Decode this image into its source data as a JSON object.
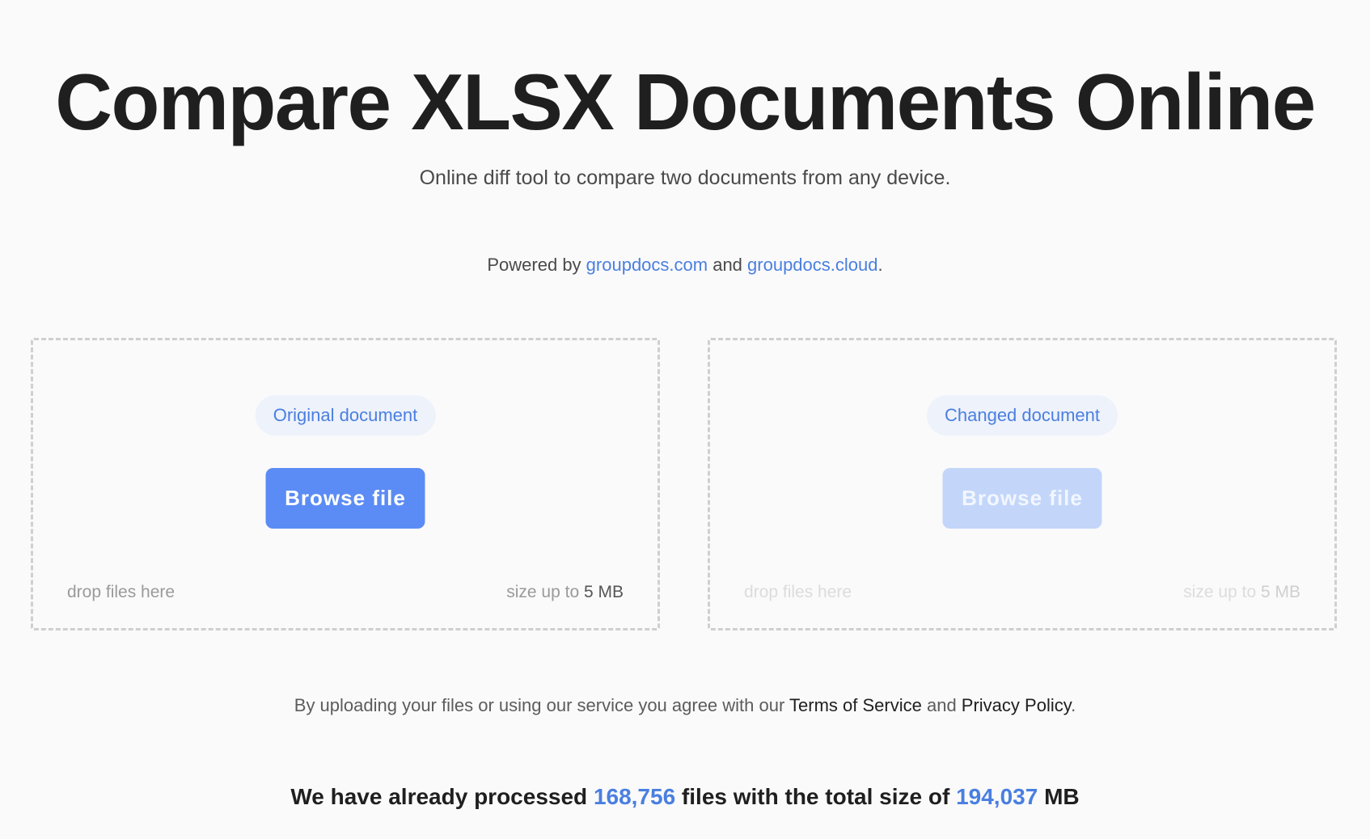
{
  "header": {
    "title": "Compare XLSX Documents Online",
    "subtitle": "Online diff tool to compare two documents from any device."
  },
  "powered": {
    "prefix": "Powered by ",
    "link1": "groupdocs.com",
    "middle": " and ",
    "link2": "groupdocs.cloud",
    "suffix": "."
  },
  "upload": {
    "original": {
      "label": "Original document",
      "button": "Browse file",
      "drop_hint": "drop files here",
      "size_prefix": "size up to ",
      "size_value": "5 MB"
    },
    "changed": {
      "label": "Changed document",
      "button": "Browse file",
      "drop_hint": "drop files here",
      "size_prefix": "size up to ",
      "size_value": "5 MB"
    }
  },
  "terms": {
    "prefix": "By uploading your files or using our service you agree with our ",
    "tos": "Terms of Service",
    "middle": " and ",
    "privacy": "Privacy Policy",
    "suffix": "."
  },
  "stats": {
    "prefix": "We have already processed ",
    "files_count": "168,756",
    "middle": " files with the total size of ",
    "total_size": "194,037",
    "suffix": " MB"
  },
  "colors": {
    "accent": "#5b8cf5",
    "link": "#4a7fe0",
    "disabled_button": "#c3d6fa",
    "pill_background": "#eef2fb"
  }
}
